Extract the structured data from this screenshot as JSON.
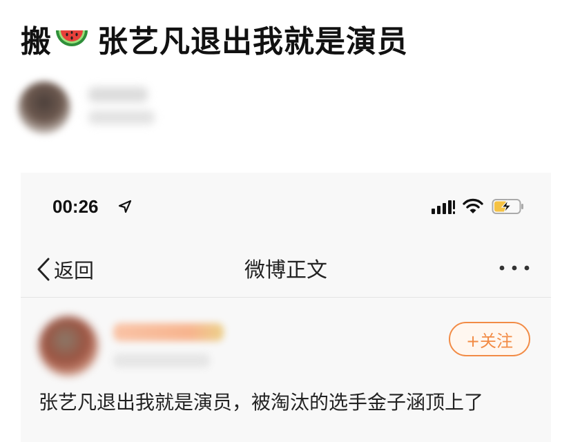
{
  "post": {
    "title": "张艺凡退出我就是演员",
    "title_prefix": "搬",
    "prefix_emoji": "watermelon-icon"
  },
  "screenshot": {
    "status_bar": {
      "time": "00:26",
      "icons": [
        "location-arrow-icon",
        "signal-bars-icon",
        "wifi-icon",
        "battery-charging-icon"
      ],
      "battery_color": "#f5c244"
    },
    "nav": {
      "back_label": "返回",
      "title": "微博正文",
      "more_icon": "more-dots-icon"
    },
    "author": {
      "follow_label": "+关注",
      "accent_color": "#f28b45"
    },
    "body_text": "张艺凡退出我就是演员，被淘汰的选手金子涵顶上了"
  }
}
